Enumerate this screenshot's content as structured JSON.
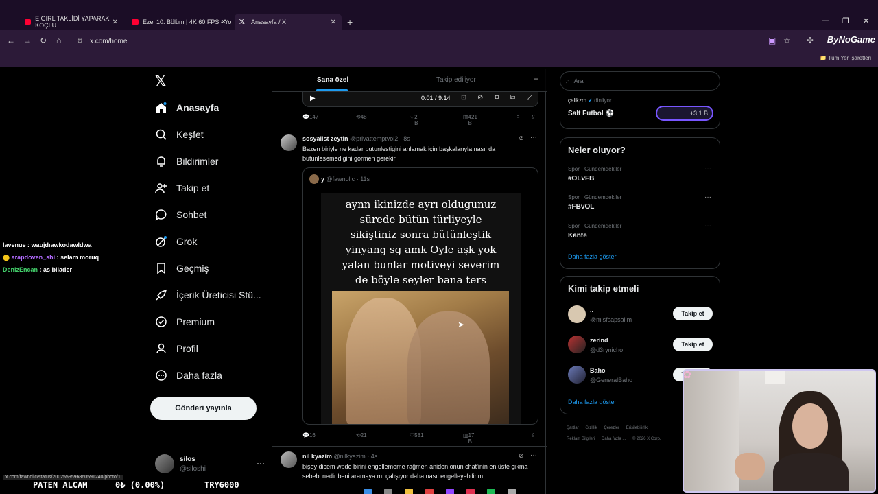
{
  "browser": {
    "tabs": [
      {
        "label": "E GIRL TAKLİDİ YAPARAK KOÇLU",
        "favicon": "youtube-icon"
      },
      {
        "label": "Ezel 10. Bölüm | 4K 60 FPS - Yo",
        "favicon": "youtube-icon"
      },
      {
        "label": "Anasayfa / X",
        "favicon": "x-icon"
      }
    ],
    "url": "x.com/home",
    "brand": "ByNoGame",
    "bookmarks_label": "Tüm Yer İşaretleri"
  },
  "nav": {
    "items": [
      {
        "label": "Anasayfa",
        "icon": "home-icon"
      },
      {
        "label": "Keşfet",
        "icon": "search-icon"
      },
      {
        "label": "Bildirimler",
        "icon": "bell-icon"
      },
      {
        "label": "Takip et",
        "icon": "person-add-icon"
      },
      {
        "label": "Sohbet",
        "icon": "chat-icon"
      },
      {
        "label": "Grok",
        "icon": "grok-icon"
      },
      {
        "label": "Geçmiş",
        "icon": "bookmark-icon"
      },
      {
        "label": "İçerik Üreticisi Stü...",
        "icon": "rocket-icon"
      },
      {
        "label": "Premium",
        "icon": "verified-icon"
      },
      {
        "label": "Profil",
        "icon": "person-icon"
      },
      {
        "label": "Daha fazla",
        "icon": "more-circle-icon"
      }
    ],
    "post_button": "Gönderi yayınla",
    "account": {
      "name": "silos",
      "handle": "@siloshi"
    }
  },
  "feed": {
    "tabs": [
      "Sana özel",
      "Takip ediliyor"
    ],
    "video_time": "0:01 / 9:14",
    "post1_stats": {
      "replies": "147",
      "reposts": "48",
      "likes": "2 B",
      "views": "421 B"
    },
    "post2": {
      "name": "sosyalist zeytin",
      "handle": "@privattemptvol2",
      "time": "· 8s",
      "text": "Bazen biriyle ne kadar butunlestigini anlamak için başkalarıyla nasıl da butunlesemedigini gormen gerekir",
      "quote": {
        "name": "y",
        "handle": "@fawnolic",
        "time": "· 11s",
        "caption_lines": [
          "aynn ikinizde ayrı oldugunuz",
          "sürede bütün türliyeyle",
          "sikiştiniz sonra bütünleştik",
          "yinyang sg amk Oyle aşk yok",
          "yalan bunlar motiveyi severim",
          "de böyle seyler bana ters"
        ]
      },
      "stats": {
        "replies": "16",
        "reposts": "21",
        "likes": "581",
        "views": "17 B"
      }
    },
    "post3": {
      "name": "nil kyazim",
      "handle": "@nilkyazim",
      "time": "· 4s",
      "text": "bişey dicem wpde birini engellememe rağmen aniden onun chat'inin en üste çıkma sebebi nedir beni aramaya mı çalışıyor daha nasıl engelleyebilirim"
    }
  },
  "right": {
    "search_placeholder": "Ara",
    "space": {
      "host": "çelikzrn",
      "status": "dinliyor",
      "title": "Salt Futbol",
      "count": "+3,1 B"
    },
    "trends_title": "Neler oluyor?",
    "trends": [
      {
        "meta": "Spor · Gündemdekiler",
        "name": "#OLvFB"
      },
      {
        "meta": "Spor · Gündemdekiler",
        "name": "#FBvOL"
      },
      {
        "meta": "Spor · Gündemdekiler",
        "name": "Kante"
      }
    ],
    "show_more": "Daha fazla göster",
    "who_title": "Kimi takip etmeli",
    "who": [
      {
        "name": "..",
        "handle": "@mlsfsapsalim",
        "button": "Takip et"
      },
      {
        "name": "zerind",
        "handle": "@d3rynicho",
        "button": "Takip et"
      },
      {
        "name": "Baho",
        "handle": "@GeneralBaho",
        "button": "Takip et"
      }
    ],
    "footer": [
      "Şartlar",
      "Gizlilik",
      "Çerezler",
      "Erişilebilirlik",
      "Reklam Bilgileri",
      "Daha fazla ...",
      "© 2026 X Corp."
    ]
  },
  "overlay": {
    "chat": [
      {
        "user": "lavenue",
        "msg": ": waujdıawkodawldwa"
      },
      {
        "user": "arapdoven_shi",
        "msg": ": selam moruq"
      },
      {
        "user": "DenizEncan",
        "msg": ": as bilader"
      }
    ],
    "ticker": {
      "left": "PATEN ALCAM",
      "mid": "0₺ (0.00%)",
      "right": "TRY6000"
    },
    "status_link": "x.com/fawnolic/status/2002559596860591240/photo/1"
  }
}
